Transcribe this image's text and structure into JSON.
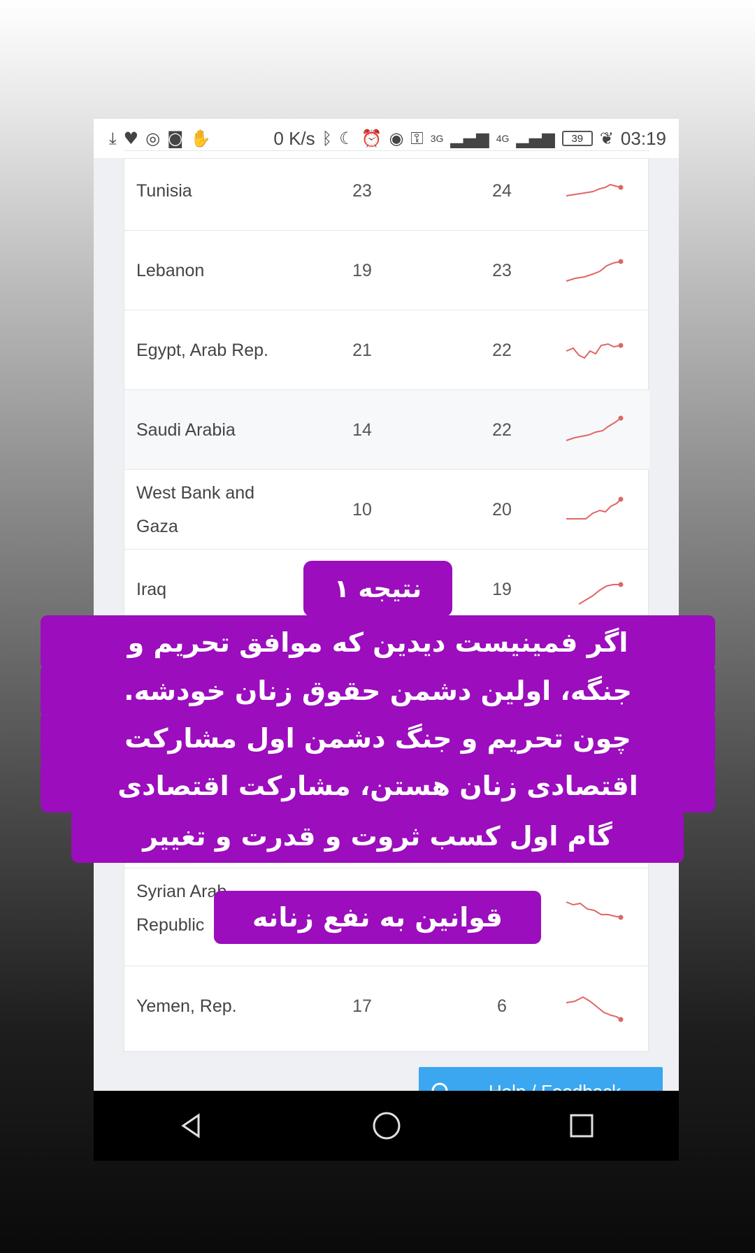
{
  "status_bar": {
    "speed": "0 K/s",
    "net_3g": "3G",
    "net_4g": "4G",
    "battery": "39",
    "time": "03:19"
  },
  "table": {
    "rows": [
      {
        "country": "Tunisia",
        "v1": "23",
        "v2": "24"
      },
      {
        "country": "Lebanon",
        "v1": "19",
        "v2": "23"
      },
      {
        "country": "Egypt, Arab Rep.",
        "v1": "21",
        "v2": "22"
      },
      {
        "country": "Saudi Arabia",
        "v1": "14",
        "v2": "22"
      },
      {
        "country": "West Bank and Gaza",
        "v1": "10",
        "v2": "20"
      },
      {
        "country": "Iraq",
        "v1": "",
        "v2": "19"
      },
      {
        "country": "",
        "v1": "",
        "v2": ""
      },
      {
        "country": "",
        "v1": "",
        "v2": ""
      },
      {
        "country": "",
        "v1": "",
        "v2": ""
      },
      {
        "country": "Syrian Arab Republic",
        "v1": "",
        "v2": ""
      },
      {
        "country": "Yemen, Rep.",
        "v1": "17",
        "v2": "6"
      }
    ]
  },
  "help": {
    "label": "Help / Feedback"
  },
  "caption": {
    "title": "نتیجه ۱",
    "lines": [
      "اگر فمینیست دیدین که موافق تحریم و",
      "جنگه، اولین دشمن حقوق زنان خودشه.",
      "چون تحریم و جنگ دشمن اول مشارکت",
      "اقتصادی زنان هستن، مشارکت اقتصادی",
      "گام اول کسب ثروت و قدرت و تغییر",
      "قوانین به نفع زنانه"
    ]
  },
  "colors": {
    "caption_bg": "#9b0dbd",
    "help_bg": "#3aa7f0",
    "sparkline": "#e06666"
  }
}
